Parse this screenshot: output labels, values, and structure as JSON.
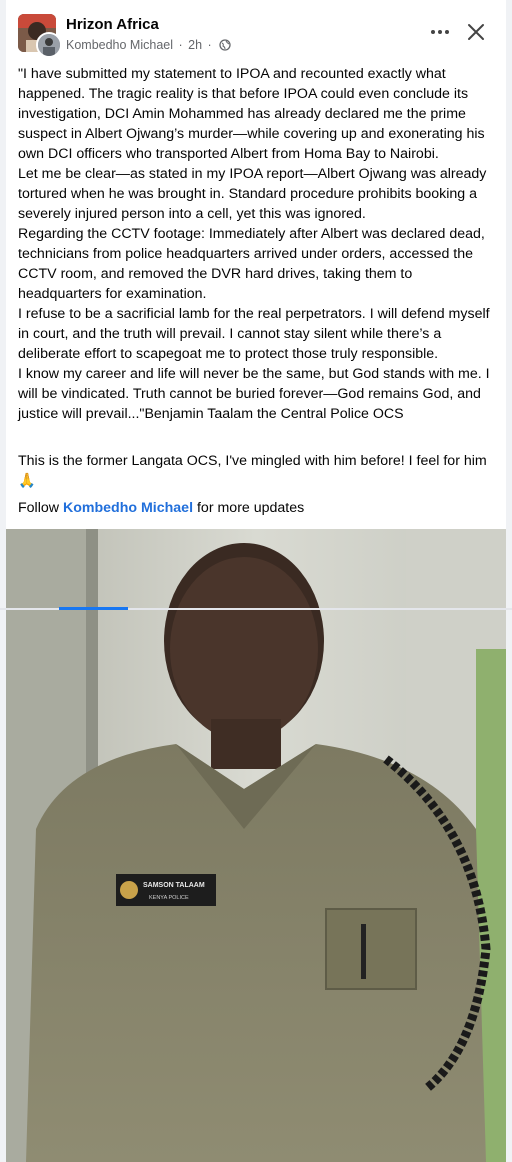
{
  "post": {
    "page_name": "Hrizon Africa",
    "author": "Kombedho Michael",
    "time": "2h",
    "separator": "·",
    "paragraphs": [
      "\"I have submitted my statement to IPOA and recounted exactly what happened. The tragic reality is that before IPOA could even conclude its investigation, DCI Amin Mohammed has already declared me the prime suspect in Albert Ojwang’s murder—while covering up and exonerating his own DCI officers who transported Albert from Homa Bay to Nairobi.",
      "Let me be clear—as stated in my IPOA report—Albert Ojwang was already tortured when he was brought in. Standard procedure prohibits booking a severely injured person into a cell, yet this was ignored.",
      "Regarding the CCTV footage: Immediately after Albert was declared dead, technicians from police headquarters arrived under orders, accessed the CCTV room, and removed the DVR hard drives, taking them to headquarters for examination.",
      "I refuse to be a sacrificial lamb for the real perpetrators. I will defend myself in court, and the truth will prevail. I cannot stay silent while there’s a deliberate effort to scapegoat me to protect those truly responsible.",
      "I know my career and life will never be the same, but God stands with me. I will be vindicated. Truth cannot be buried forever—God remains God, and justice will prevail...\"Benjamin Taalam the Central Police OCS"
    ],
    "comment": "This is the former Langata OCS, I've mingled with him before! I feel for him 🙏",
    "follow_prefix": "Follow",
    "follow_link": "Kombedho Michael",
    "follow_suffix": "for more updates"
  },
  "photo": {
    "nametag_line1": "SAMSON TALAAM",
    "nametag_line2": "KENYA POLICE"
  },
  "icons": {
    "more": "more-options-icon",
    "close": "close-icon",
    "audience": "globe-icon"
  },
  "colors": {
    "link": "#216fdb",
    "tab_indicator": "#1877f2",
    "meta_text": "#65676b"
  }
}
